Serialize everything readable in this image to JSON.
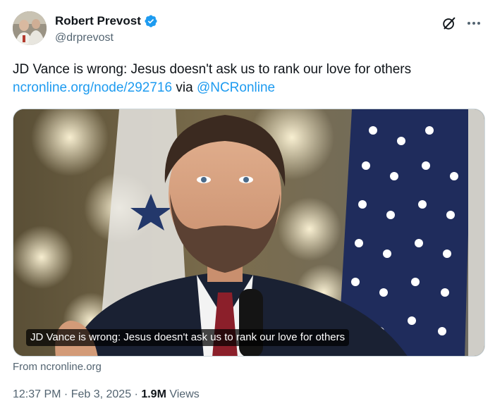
{
  "author": {
    "display_name": "Robert Prevost",
    "handle": "@drprevost",
    "verified": true
  },
  "tweet": {
    "text": "JD Vance is wrong: Jesus doesn't ask us to rank our love for others",
    "link": "ncronline.org/node/292716",
    "via_text": " via ",
    "mention": "@NCRonline"
  },
  "card": {
    "title": "JD Vance is wrong: Jesus doesn't ask us to rank our love for others",
    "source": "From ncronline.org"
  },
  "meta": {
    "time": "12:37 PM",
    "separator": " · ",
    "date": "Feb 3, 2025",
    "separator2": " · ",
    "views_count": "1.9M",
    "views_label": " Views"
  },
  "icons": {
    "grok": "grok-icon",
    "more": "more-icon",
    "verified": "verified-badge-icon"
  },
  "colors": {
    "link": "#1d9bf0",
    "verified": "#1d9bf0",
    "secondary_text": "#536471",
    "primary_text": "#0f1419"
  }
}
